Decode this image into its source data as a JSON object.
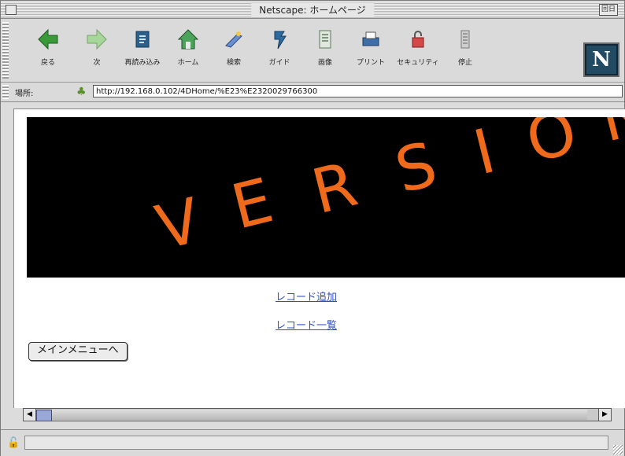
{
  "window": {
    "title": "Netscape: ホームページ",
    "zoom_label": "回日"
  },
  "toolbar": {
    "buttons": [
      {
        "label": "戻る",
        "icon": "back-arrow-icon"
      },
      {
        "label": "次",
        "icon": "forward-arrow-icon"
      },
      {
        "label": "再読み込み",
        "icon": "reload-icon"
      },
      {
        "label": "ホーム",
        "icon": "home-icon"
      },
      {
        "label": "検索",
        "icon": "search-icon"
      },
      {
        "label": "ガイド",
        "icon": "guide-icon"
      },
      {
        "label": "画像",
        "icon": "images-icon"
      },
      {
        "label": "プリント",
        "icon": "print-icon"
      },
      {
        "label": "セキュリティ",
        "icon": "security-lock-icon"
      },
      {
        "label": "停止",
        "icon": "stop-icon"
      }
    ],
    "logo_text": "N"
  },
  "location": {
    "label": "場所:",
    "url": "http://192.168.0.102/4DHome/%E23%E2320029766300"
  },
  "banner": {
    "letters": [
      "V",
      "E",
      "R",
      "S",
      "I",
      "O",
      "N"
    ],
    "color": "#f06a1c",
    "background": "#000000"
  },
  "links": {
    "add_record": "レコード追加",
    "list_records": "レコード一覧"
  },
  "main_menu_button": "メインメニューへ",
  "colors": {
    "link": "#3050c0",
    "chrome": "#dadada",
    "scroll_thumb": "#9aa8d8"
  }
}
